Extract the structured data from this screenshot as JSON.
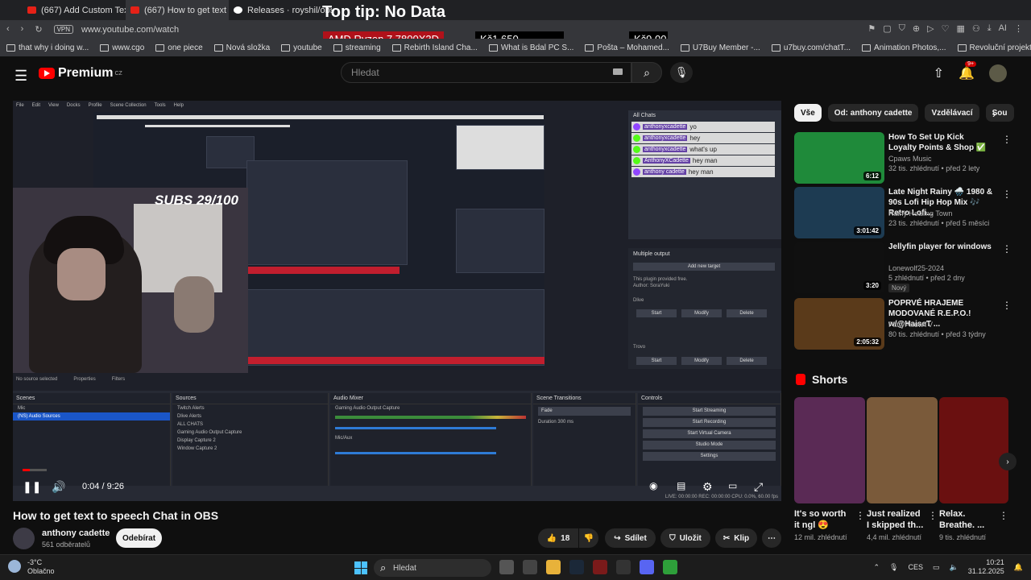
{
  "browser": {
    "tabs": [
      {
        "label": "(667) Add Custom Text-To",
        "active": false
      },
      {
        "label": "(667) How to get text t",
        "active": true
      },
      {
        "label": "Releases · royshil/obs",
        "active": false
      }
    ],
    "overlay_tip": "Top tip: No Data",
    "vpn_label": "VPN",
    "url": "www.youtube.com/watch",
    "price_ticker": [
      {
        "label": "AMD Ryzen 7 7800X3D"
      },
      {
        "label": "Kč1,650"
      },
      {
        "label": "Kč9,00"
      }
    ],
    "bookmarks": [
      "that why i doing w...",
      "www.cgo",
      "one piece",
      "Nová složka",
      "youtube",
      "streaming",
      "Rebirth Island Cha...",
      "What is Bdal PC S...",
      "Pošta – Mohamed...",
      "U7Buy Member -...",
      "u7buy.com/chatT...",
      "Animation Photos,...",
      "Revoluční projekto...",
      "Dlouhodobý proná..."
    ]
  },
  "youtube": {
    "logo_text": "Premium",
    "logo_region": "CZ",
    "search_placeholder": "Hledat",
    "notification_badge": "9+"
  },
  "player": {
    "subs_overlay": "SUBS 29/100",
    "time": "0:04 / 9:26",
    "progress": 0.0071,
    "obs": {
      "menu": [
        "File",
        "Edit",
        "View",
        "Docks",
        "Profile",
        "Scene Collection",
        "Tools",
        "Help"
      ],
      "all_chats_title": "All Chats",
      "chat_lines": [
        {
          "user": "anthonyxcadette",
          "text": "yo",
          "color": "#9146ff"
        },
        {
          "user": "anthonyxcadette",
          "text": "hey",
          "color": "#53fc18"
        },
        {
          "user": "anthonyxcadette",
          "text": "what's up",
          "color": "#53fc18"
        },
        {
          "user": "AnthonyXCadette",
          "text": "hey man",
          "color": "#53fc18"
        },
        {
          "user": "anthony cadette",
          "text": "hey man",
          "color": "#9146ff"
        }
      ],
      "multiple_output_title": "Multiple output",
      "add_new_target": "Add new target",
      "plugin_text": "This plugin provided free.",
      "author_text": "Author: SoraYuki",
      "targets": [
        {
          "name": "Dlive",
          "buttons": [
            "Start",
            "Modify",
            "Delete"
          ]
        },
        {
          "name": "Trovo",
          "buttons": [
            "Start",
            "Modify",
            "Delete"
          ]
        }
      ],
      "no_source": "No source selected",
      "properties": "Properties",
      "filters": "Filters",
      "docks": {
        "scenes": {
          "title": "Scenes",
          "items": [
            "Mic",
            "(NS) Audio Sources"
          ]
        },
        "sources": {
          "title": "Sources",
          "items": [
            "Twitch Alerts",
            "Dlive Alerts",
            "ALL CHATS",
            "Gaming Audio Output Capture",
            "Display Capture 2",
            "Window Capture 2"
          ]
        },
        "mixer": {
          "title": "Audio Mixer",
          "channels": [
            "Gaming Audio Output Capture",
            "Mic/Aux"
          ]
        },
        "transitions": {
          "title": "Scene Transitions",
          "value": "Fade",
          "duration_label": "Duration",
          "duration": "300 ms"
        },
        "controls": {
          "title": "Controls",
          "buttons": [
            "Start Streaming",
            "Start Recording",
            "Start Virtual Camera",
            "Studio Mode",
            "Settings"
          ]
        }
      },
      "status": "LIVE: 00:00:00   REC: 00:00:00   CPU: 0.0%, 60.00 fps"
    }
  },
  "video": {
    "title": "How to get text to speech Chat in OBS",
    "channel": "anthony cadette",
    "subscribers": "561 odběratelů",
    "subscribe": "Odebírat",
    "likes": "18",
    "share": "Sdílet",
    "save": "Uložit",
    "clip": "Klip"
  },
  "sidebar": {
    "chips": [
      {
        "label": "Vše",
        "active": true
      },
      {
        "label": "Od: anthony cadette",
        "active": false
      },
      {
        "label": "Vzdělávací",
        "active": false
      },
      {
        "label": "Sou",
        "active": false
      }
    ],
    "recommendations": [
      {
        "title": "How To Set Up Kick Loyalty Points & Shop ✅",
        "channel": "Cpaws Music",
        "verified": true,
        "meta": "32 tis. zhlédnutí • před 2 lety",
        "duration": "6:12",
        "color": "#1f8a3a"
      },
      {
        "title": "Late Night Rainy 🌧️ 1980 & 90s Lofi Hip Hop Mix 🎶 Retro Lofi...",
        "channel": "Rainy Healing Town",
        "verified": false,
        "meta": "23 tis. zhlédnutí • před 5 měsíci",
        "duration": "3:01:42",
        "color": "#1d3b52"
      },
      {
        "title": "Jellyfin player for windows",
        "channel": "Lonewolf25-2024",
        "verified": false,
        "meta": "5 zhlédnutí • před 2 dny",
        "duration": "3:20",
        "badge": "Nový",
        "color": "#101010"
      },
      {
        "title": "POPRVÉ HRAJEME MODOVANÉ R.E.P.O.! w/@HaiseT ...",
        "channel": "FattyPillowTV",
        "verified": true,
        "meta": "80 tis. zhlédnutí • před 3 týdny",
        "duration": "2:05:32",
        "color": "#5a3a1a"
      }
    ],
    "shorts_title": "Shorts",
    "shorts": [
      {
        "title": "It's so worth it ngl 😍",
        "views": "12 mil. zhlédnutí",
        "color": "#5a2a55"
      },
      {
        "title": "Just realized I skipped th...",
        "views": "4,4 mil. zhlédnutí",
        "color": "#7a5a3a"
      },
      {
        "title": "Relax. Breathe. ...",
        "views": "9 tis. zhlédnutí",
        "color": "#6a1010"
      }
    ]
  },
  "taskbar": {
    "temp": "-3°C",
    "condition": "Oblačno",
    "search": "Hledat",
    "lang": "CES",
    "time": "10:21",
    "date": "31.12.2025"
  }
}
